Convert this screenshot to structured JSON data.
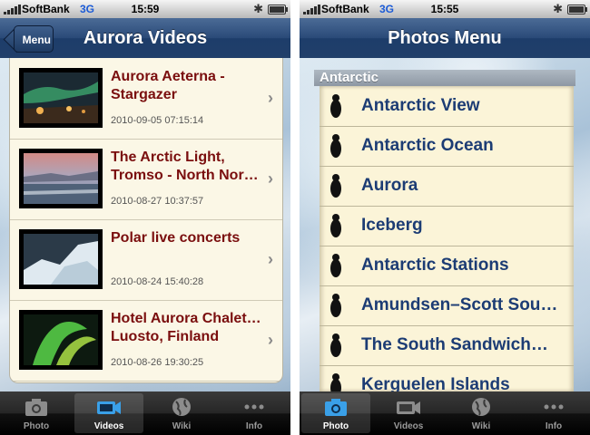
{
  "status_bar": {
    "carrier": "SoftBank",
    "network": "3G",
    "time_left": "15:59",
    "time_right": "15:55"
  },
  "left_screen": {
    "nav": {
      "title": "Aurora Videos",
      "back_label": "Menu"
    },
    "videos": [
      {
        "title_line1": "Aurora Aeterna -",
        "title_line2": "Stargazer",
        "date": "2010-09-05 07:15:14",
        "thumbnail": "aurora-over-town"
      },
      {
        "title_line1": "The Arctic Light,",
        "title_line2": "Tromso - North Nor…",
        "date": "2010-08-27 10:37:57",
        "thumbnail": "arctic-sunset-sea"
      },
      {
        "title_line1": "Polar live concerts",
        "title_line2": "",
        "date": "2010-08-24 15:40:28",
        "thumbnail": "ice-landscape"
      },
      {
        "title_line1": "Hotel Aurora Chalet in",
        "title_line2": "Luosto, Finland",
        "date": "2010-08-26 19:30:25",
        "thumbnail": "green-aurora"
      }
    ],
    "active_tab": "Videos"
  },
  "right_screen": {
    "nav": {
      "title": "Photos Menu"
    },
    "section_header": "Antarctic",
    "items": [
      "Antarctic View",
      "Antarctic Ocean",
      "Aurora",
      "Iceberg",
      "Antarctic Stations",
      "Amundsen–Scott Sou…",
      "The South Sandwich…",
      "Kerguelen Islands"
    ],
    "active_tab": "Photo"
  },
  "tabs": [
    {
      "label": "Photo",
      "icon": "camera-icon"
    },
    {
      "label": "Videos",
      "icon": "video-camera-icon"
    },
    {
      "label": "Wiki",
      "icon": "globe-icon"
    },
    {
      "label": "Info",
      "icon": "more-icon"
    }
  ],
  "colors": {
    "nav_blue": "#213f6a",
    "video_title": "#7a0e0e",
    "photo_label": "#1c3c74",
    "card_bg": "#fbf7e6",
    "tab_active_blue": "#3aa0e8"
  }
}
